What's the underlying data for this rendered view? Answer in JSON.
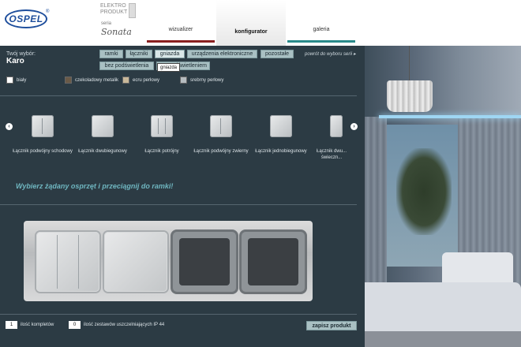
{
  "header": {
    "logo_text": "OSPEL",
    "logo_mark": "®",
    "elektro_text": "ELEKTRO PRODUKT",
    "seria_label": "seria",
    "seria_name": "Sonata",
    "nav": [
      {
        "label": "wizualizer"
      },
      {
        "label": "konfigurator"
      },
      {
        "label": "galeria"
      }
    ]
  },
  "selection": {
    "label": "Twój wybór:",
    "value": "Karo"
  },
  "tabs": {
    "row1": [
      "ramki",
      "łączniki",
      "gniazda",
      "urządzenia elektroniczne",
      "pozostałe"
    ],
    "row2_first": "bez podświetlenia",
    "row2_second": "podświetleniem",
    "tooltip": "gniazda"
  },
  "back_link": "powrót do wyboru serii",
  "colors": [
    {
      "label": "biały",
      "hex": "#ffffff"
    },
    {
      "label": "czekoladowy metalik",
      "hex": "#6a5a48"
    },
    {
      "label": "ecru perłowy",
      "hex": "#c9b89a"
    },
    {
      "label": "srebrny perłowy",
      "hex": "#b6bcc0"
    }
  ],
  "items": [
    {
      "name": "Łącznik podwójny schodowy",
      "icon": "double-switch-icon"
    },
    {
      "name": "Łącznik dwubiegunowy",
      "icon": "switch-icon"
    },
    {
      "name": "Łącznik potrójny",
      "icon": "triple-switch-icon"
    },
    {
      "name": "Łącznik podwójny zwierny",
      "icon": "double-switch-icon"
    },
    {
      "name": "Łącznik jednobiegunowy",
      "icon": "switch-icon"
    },
    {
      "name": "Łącznik dwu... świeczn...",
      "icon": "switch-icon"
    }
  ],
  "hint": "Wybierz żądany osprzęt i przeciągnij do ramki!",
  "frame_slots": [
    {
      "state": "filled",
      "type": "triple-switch"
    },
    {
      "state": "filled",
      "type": "switch"
    },
    {
      "state": "empty"
    },
    {
      "state": "empty"
    }
  ],
  "footer": {
    "kit_qty": "1",
    "kit_label": "ilość kompletów",
    "ip_qty": "0",
    "ip_label": "ilość zestawów uszczelniających IP 44",
    "save_label": "zapisz produkt"
  }
}
